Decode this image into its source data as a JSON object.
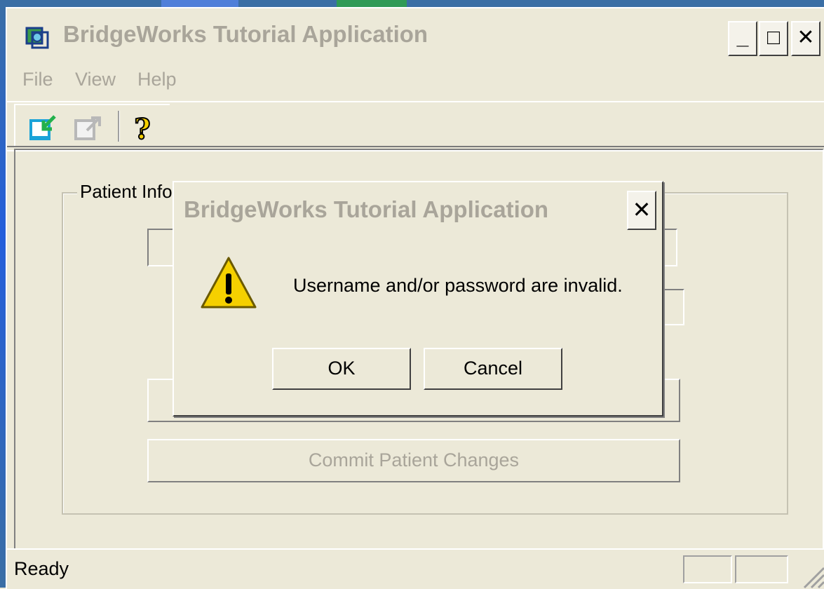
{
  "window": {
    "title": "BridgeWorks Tutorial Application",
    "controls": {
      "minimize": "_",
      "maximize": "□",
      "close": "✕"
    }
  },
  "menu": {
    "items": [
      "File",
      "View",
      "Help"
    ]
  },
  "toolbar": {
    "buttons": [
      {
        "icon": "connect-icon",
        "enabled": true
      },
      {
        "icon": "disconnect-icon",
        "enabled": false
      },
      {
        "icon": "help-icon",
        "enabled": true
      }
    ]
  },
  "main": {
    "group_label": "Patient Info",
    "commit_button": "Commit Patient Changes"
  },
  "status": {
    "text": "Ready"
  },
  "dialog": {
    "title": "BridgeWorks Tutorial Application",
    "close": "✕",
    "icon": "warning-icon",
    "message": "Username and/or password are invalid.",
    "ok_label": "OK",
    "cancel_label": "Cancel"
  },
  "colors": {
    "window_bg": "#ece9d8",
    "inactive_text": "#a9a59a",
    "warning_yellow": "#f5d000"
  }
}
